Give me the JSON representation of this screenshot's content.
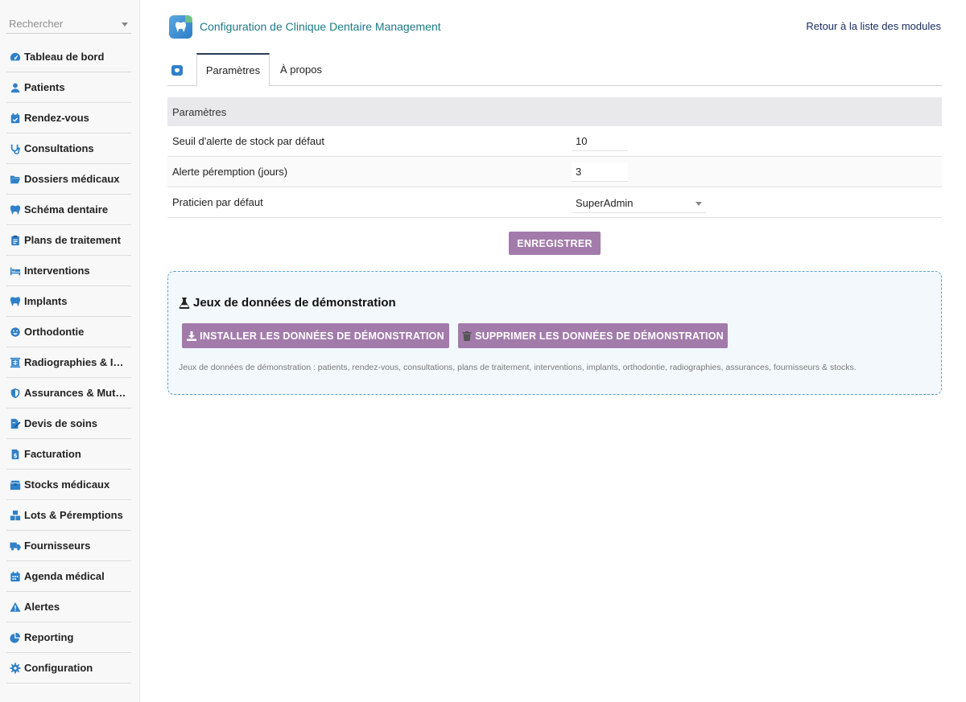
{
  "sidebar": {
    "search_placeholder": "Rechercher",
    "items": [
      {
        "label": "Tableau de bord",
        "icon": "dashboard-icon"
      },
      {
        "label": "Patients",
        "icon": "user-icon"
      },
      {
        "label": "Rendez-vous",
        "icon": "calendar-check-icon"
      },
      {
        "label": "Consultations",
        "icon": "stethoscope-icon"
      },
      {
        "label": "Dossiers médicaux",
        "icon": "folder-open-icon"
      },
      {
        "label": "Schéma dentaire",
        "icon": "tooth-icon"
      },
      {
        "label": "Plans de traitement",
        "icon": "clipboard-list-icon"
      },
      {
        "label": "Interventions",
        "icon": "procedure-bed-icon"
      },
      {
        "label": "Implants",
        "icon": "tooth-icon"
      },
      {
        "label": "Orthodontie",
        "icon": "smile-icon"
      },
      {
        "label": "Radiographies & Imagerie",
        "icon": "x-ray-icon"
      },
      {
        "label": "Assurances & Mutuelles",
        "icon": "shield-icon"
      },
      {
        "label": "Devis de soins",
        "icon": "file-signature-icon"
      },
      {
        "label": "Facturation",
        "icon": "invoice-icon"
      },
      {
        "label": "Stocks médicaux",
        "icon": "box-icon"
      },
      {
        "label": "Lots & Péremptions",
        "icon": "boxes-icon"
      },
      {
        "label": "Fournisseurs",
        "icon": "truck-icon"
      },
      {
        "label": "Agenda médical",
        "icon": "calendar-icon"
      },
      {
        "label": "Alertes",
        "icon": "warning-icon"
      },
      {
        "label": "Reporting",
        "icon": "pie-chart-icon"
      },
      {
        "label": "Configuration",
        "icon": "gear-icon"
      }
    ]
  },
  "header": {
    "title": "Configuration de Clinique Dentaire Management",
    "back_link": "Retour à la liste des modules"
  },
  "tabs": [
    {
      "label": "Paramètres",
      "active": true
    },
    {
      "label": "À propos",
      "active": false
    }
  ],
  "settings": {
    "heading": "Paramètres",
    "rows": [
      {
        "label": "Seuil d'alerte de stock par défaut",
        "value": "10"
      },
      {
        "label": "Alerte péremption (jours)",
        "value": "3"
      },
      {
        "label": "Praticien par défaut",
        "value": "SuperAdmin"
      }
    ],
    "save_label": "ENREGISTRER"
  },
  "demo": {
    "title": "Jeux de données de démonstration",
    "install_label": "INSTALLER LES DONNÉES DE DÉMONSTRATION",
    "delete_label": "SUPPRIMER LES DONNÉES DE DÉMONSTRATION",
    "note": "Jeux de données de démonstration : patients, rendez-vous, consultations, plans de traitement, interventions, implants, orthodontie, radiographies, assurances, fournisseurs & stocks."
  },
  "colors": {
    "accent": "#2f80c8",
    "title_teal": "#1d7a86",
    "button_purple": "#a27bab",
    "demo_bg": "#f2f8fc",
    "demo_border": "#5b9fd1"
  }
}
